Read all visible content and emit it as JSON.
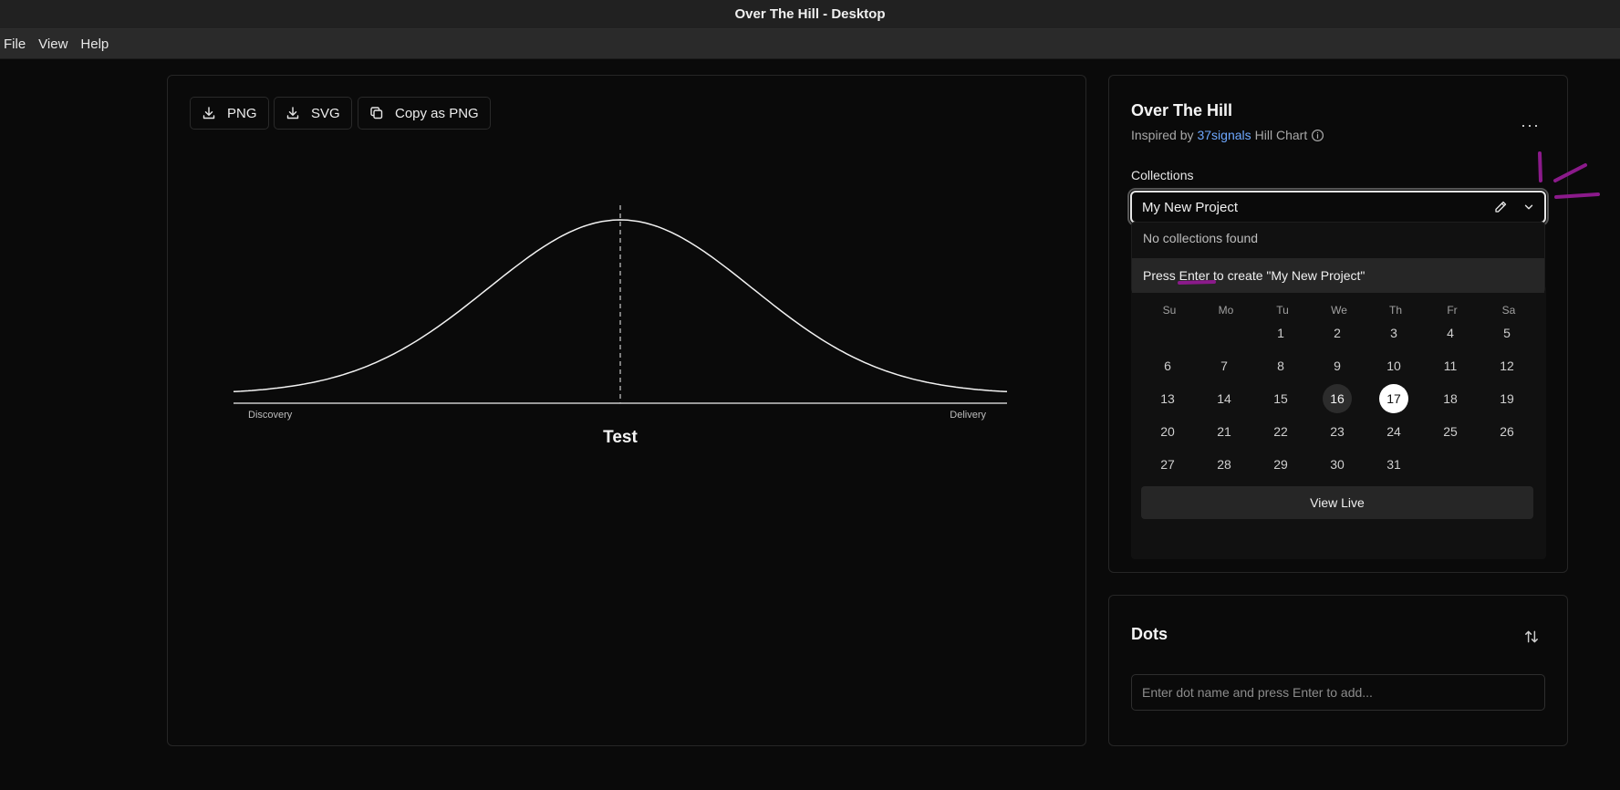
{
  "window": {
    "title": "Over The Hill - Desktop"
  },
  "menu": {
    "items": [
      "File",
      "View",
      "Help"
    ]
  },
  "toolbar": {
    "png_label": "PNG",
    "svg_label": "SVG",
    "copy_label": "Copy as PNG"
  },
  "chart": {
    "title": "Test",
    "left_label": "Discovery",
    "right_label": "Delivery"
  },
  "chart_data": {
    "type": "line",
    "title": "Test",
    "xlabel": "",
    "ylabel": "",
    "x_tick_labels": [
      "Discovery",
      "Delivery"
    ],
    "series": [
      {
        "values": []
      }
    ],
    "annotations": [
      "dashed vertical line at peak (midpoint)"
    ],
    "grid": false
  },
  "sidebar": {
    "app_title": "Over The Hill",
    "subtitle_prefix": "Inspired by ",
    "subtitle_link": "37signals",
    "subtitle_suffix": " Hill Chart",
    "more_label": "···",
    "collections_label": "Collections",
    "collection_value": "My New Project",
    "dropdown": {
      "empty_text": "No collections found",
      "create_text": "Press Enter to create \"My New Project\""
    },
    "calendar": {
      "weekdays": [
        "Su",
        "Mo",
        "Tu",
        "We",
        "Th",
        "Fr",
        "Sa"
      ],
      "start_offset": 2,
      "days": [
        "1",
        "2",
        "3",
        "4",
        "5",
        "6",
        "7",
        "8",
        "9",
        "10",
        "11",
        "12",
        "13",
        "14",
        "15",
        "16",
        "17",
        "18",
        "19",
        "20",
        "21",
        "22",
        "23",
        "24",
        "25",
        "26",
        "27",
        "28",
        "29",
        "30",
        "31"
      ],
      "today": "16",
      "selected": "17",
      "view_live_label": "View Live"
    }
  },
  "dots": {
    "title": "Dots",
    "input_placeholder": "Enter dot name and press Enter to add..."
  },
  "colors": {
    "background": "#0a0a0a",
    "link": "#6ea8ff",
    "annotation": "#8b1a8b"
  }
}
